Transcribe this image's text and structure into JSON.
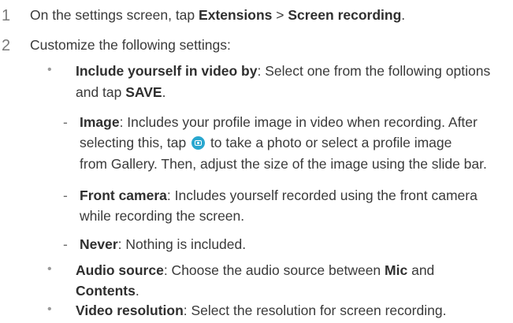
{
  "steps": [
    {
      "number": "1",
      "pre": "On the settings screen, tap ",
      "extensions": "Extensions",
      "sep": " > ",
      "screen_recording": "Screen recording",
      "post": "."
    },
    {
      "number": "2",
      "text": "Customize the following settings:"
    }
  ],
  "include": {
    "term": "Include yourself in video by",
    "line1": ": Select one from the following options",
    "line2_pre": "and tap ",
    "save": "SAVE",
    "line2_post": "."
  },
  "image_opt": {
    "term": "Image",
    "line1": ": Includes your profile image in video when recording. After",
    "line2_pre": "selecting this, tap ",
    "icon": "camera-icon",
    "line2_post": " to take a photo or select a profile image",
    "line3": "from Gallery. Then, adjust the size of the image using the slide bar."
  },
  "front_opt": {
    "term": "Front camera",
    "line1": ": Includes yourself recorded using the front camera",
    "line2": "while recording the screen."
  },
  "never_opt": {
    "term": "Never",
    "line1": ": Nothing is included."
  },
  "audio": {
    "term": "Audio source",
    "line1": ": Choose the audio source between ",
    "mic": "Mic",
    "and": " and",
    "contents": "Contents",
    "end": "."
  },
  "video": {
    "term": "Video resolution",
    "line1": ": Select the resolution for screen recording."
  },
  "marks": {
    "bullet": "•",
    "dash": "-"
  },
  "colors": {
    "icon_accent": "#29a7cf"
  }
}
